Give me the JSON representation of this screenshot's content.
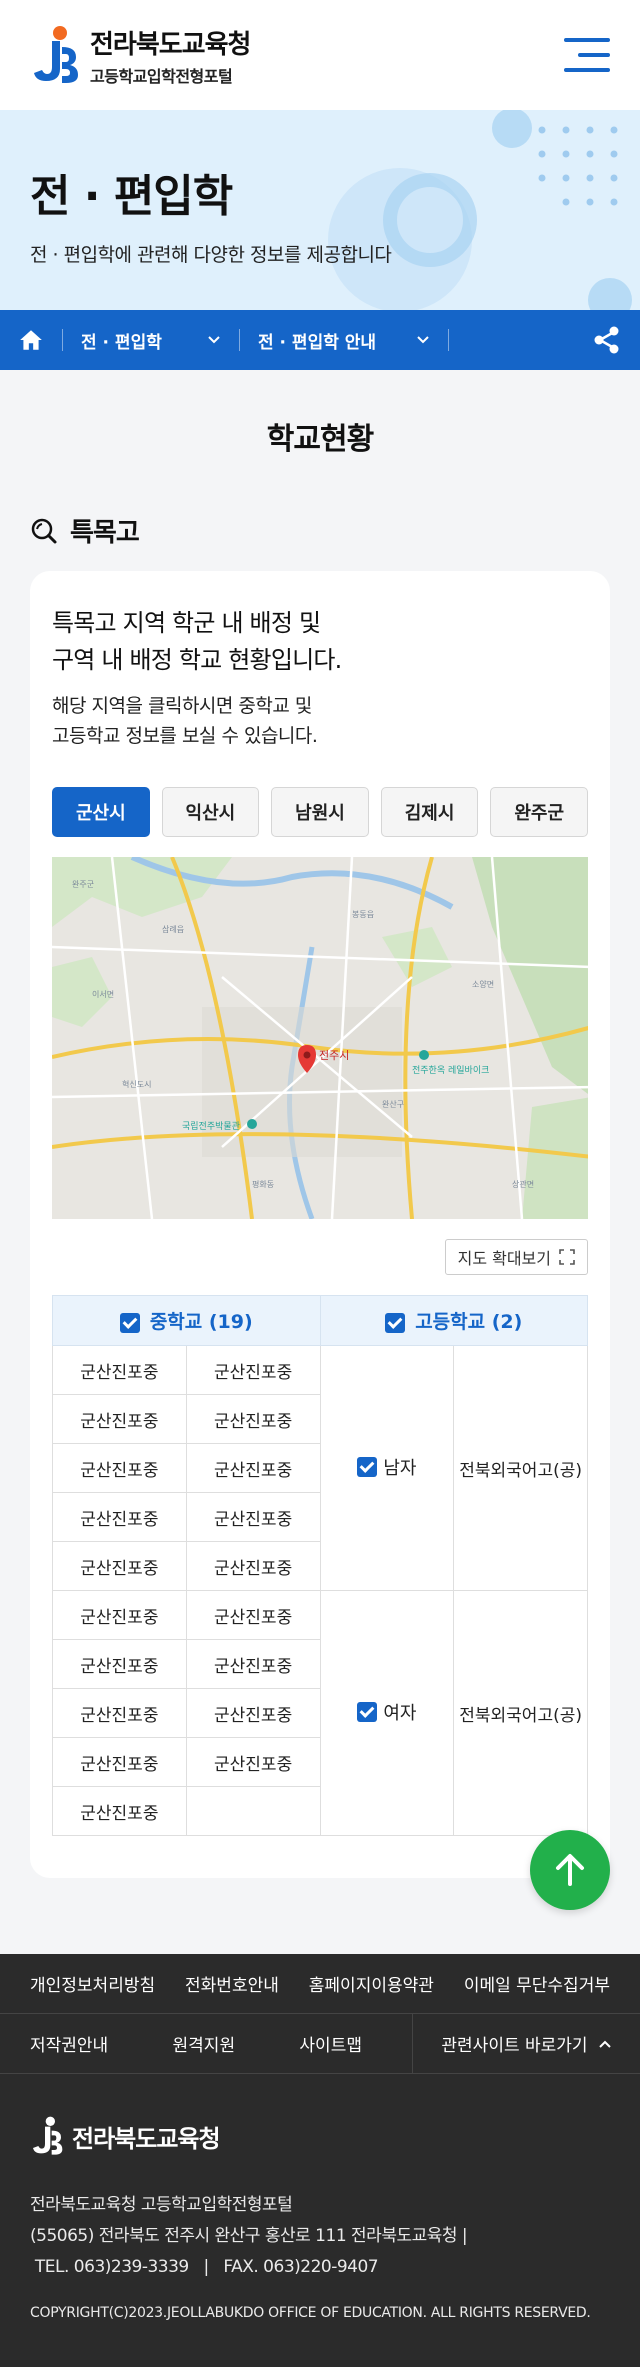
{
  "header": {
    "org_name": "전라북도교육청",
    "portal_name": "고등학교입학전형포털"
  },
  "hero": {
    "title": "전 · 편입학",
    "subtitle": "전 · 편입학에 관련해 다양한 정보를 제공합니다"
  },
  "breadcrumb": {
    "level1": "전 · 편입학",
    "level2": "전 · 편입학 안내"
  },
  "page_title": "학교현황",
  "section": {
    "title": "특목고",
    "lead_line1": "특목고 지역 학군 내 배정 및",
    "lead_line2": "구역 내 배정 학교 현황입니다.",
    "desc_line1": "해당 지역을 클릭하시면 중학교 및",
    "desc_line2": "고등학교 정보를 보실 수 있습니다."
  },
  "region_tabs": [
    "군산시",
    "익산시",
    "남원시",
    "김제시",
    "완주군"
  ],
  "active_tab": "군산시",
  "map": {
    "marker_label": "전주시",
    "poi_label_1": "국립전주박물관",
    "poi_label_2": "전주한옥 레일바이크"
  },
  "zoom_button": "지도 확대보기",
  "table": {
    "middle_header": "중학교 (19)",
    "high_header": "고등학교 (2)",
    "middle_rows": [
      [
        "군산진포중",
        "군산진포중"
      ],
      [
        "군산진포중",
        "군산진포중"
      ],
      [
        "군산진포중",
        "군산진포중"
      ],
      [
        "군산진포중",
        "군산진포중"
      ],
      [
        "군산진포중",
        "군산진포중"
      ],
      [
        "군산진포중",
        "군산진포중"
      ],
      [
        "군산진포중",
        "군산진포중"
      ],
      [
        "군산진포중",
        "군산진포중"
      ],
      [
        "군산진포중",
        "군산진포중"
      ],
      [
        "군산진포중",
        ""
      ]
    ],
    "male_label": "남자",
    "male_school": "전북외국어고(공)",
    "female_label": "여자",
    "female_school": "전북외국어고(공)"
  },
  "footer": {
    "links_row1": [
      "개인정보처리방침",
      "전화번호안내",
      "홈페이지이용약관",
      "이메일 무단수집거부"
    ],
    "links_row2": [
      "저작권안내",
      "원격지원",
      "사이트맵"
    ],
    "related_sites": "관련사이트 바로가기",
    "logo_text": "전라북도교육청",
    "info_line1": "전라북도교육청 고등학교입학전형포털",
    "info_line2": "(55065) 전라북도 전주시 완산구 홍산로 111 전라북도교육청  |",
    "info_line3": " TEL. 063)239-3339   |   FAX. 063)220-9407",
    "copyright": "COPYRIGHT(C)2023.JEOLLABUKDO OFFICE OF EDUCATION. ALL RIGHTS RESERVED."
  },
  "colors": {
    "primary": "#1565c8",
    "accent_green": "#22b04b",
    "logo_orange": "#f26a21",
    "hero_bg": "#dff0fc",
    "footer_bg": "#2b2b2b"
  }
}
